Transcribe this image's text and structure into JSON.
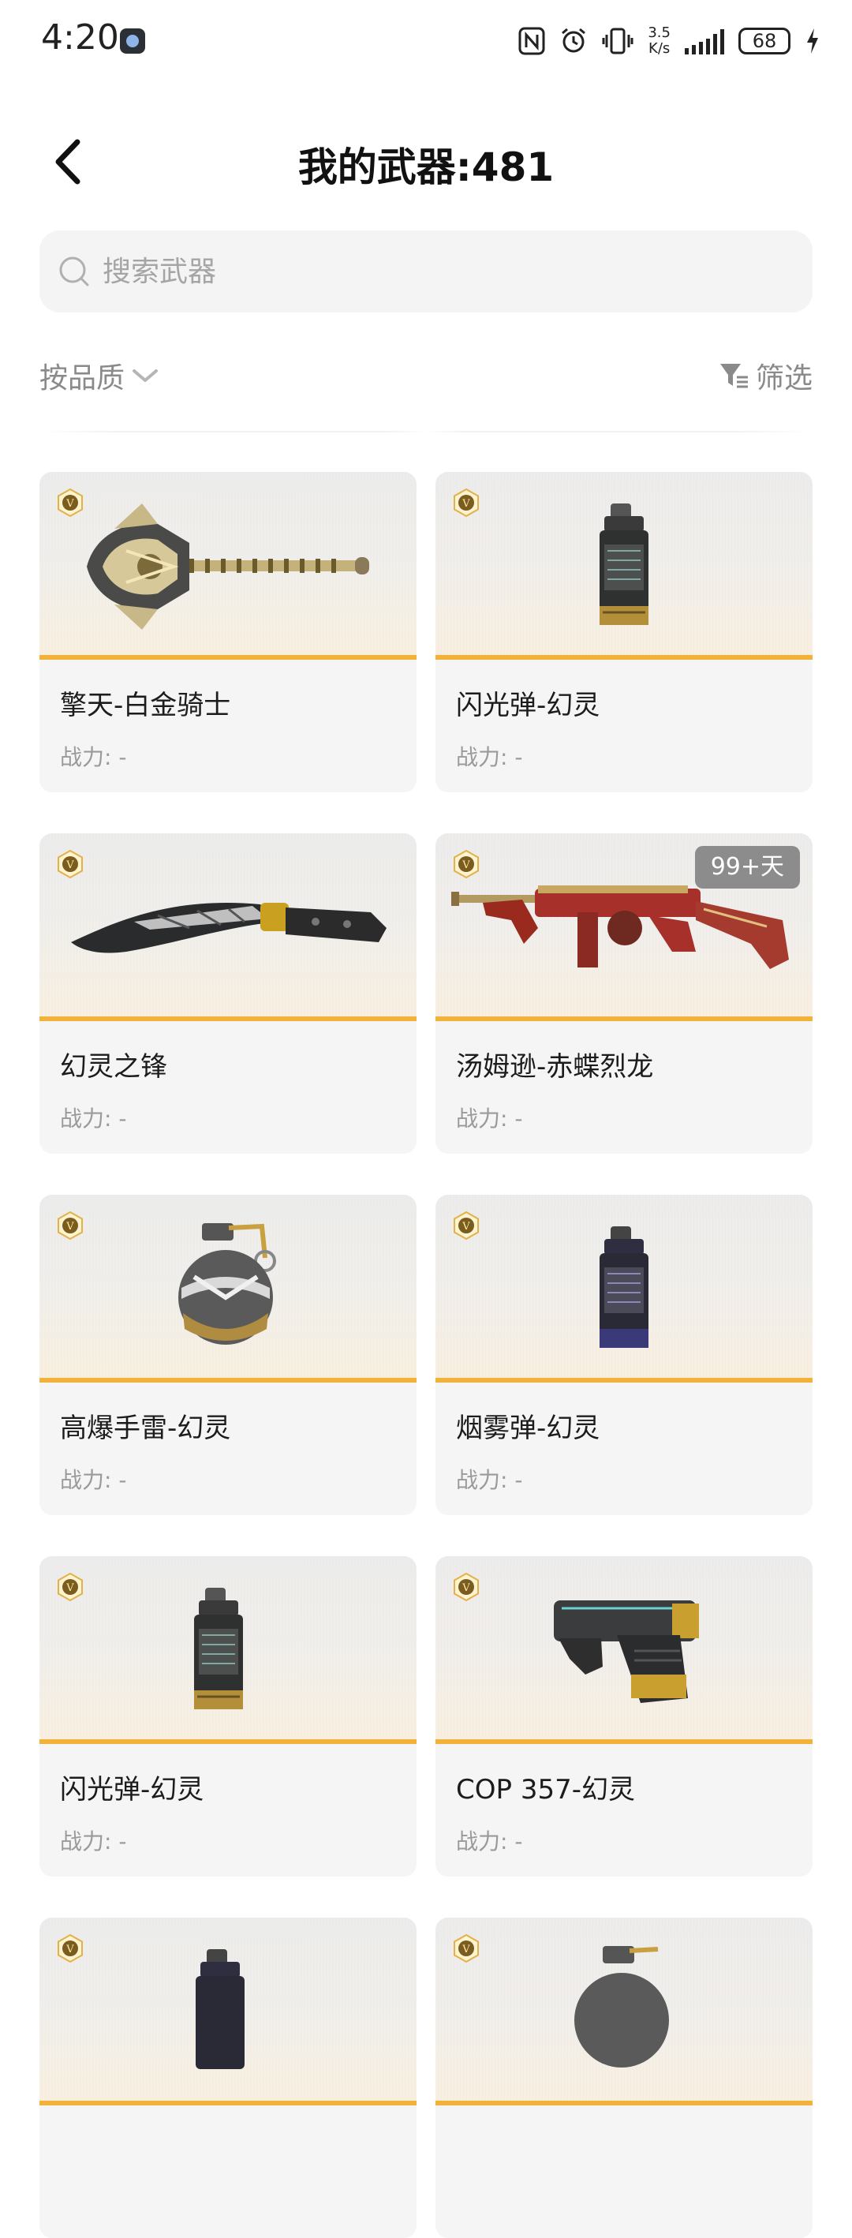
{
  "status_bar": {
    "time": "4:20",
    "net_speed_value": "3.5",
    "net_speed_unit": "K/s",
    "battery": "68"
  },
  "header": {
    "title": "我的武器:481"
  },
  "search": {
    "placeholder": "搜索武器",
    "value": ""
  },
  "toolbar": {
    "sort_label": "按品质",
    "filter_label": "筛选"
  },
  "weapons": [
    {
      "name": "擎天-白金骑士",
      "power": "战力: -",
      "art": "shovel-icon"
    },
    {
      "name": "闪光弹-幻灵",
      "power": "战力: -",
      "art": "flashbang-icon"
    },
    {
      "name": "幻灵之锋",
      "power": "战力: -",
      "art": "kukri-knife-icon"
    },
    {
      "name": "汤姆逊-赤蝶烈龙",
      "power": "战力: -",
      "art": "tommy-gun-icon",
      "badge": "99+天"
    },
    {
      "name": "高爆手雷-幻灵",
      "power": "战力: -",
      "art": "frag-grenade-icon"
    },
    {
      "name": "烟雾弹-幻灵",
      "power": "战力: -",
      "art": "smoke-grenade-icon"
    },
    {
      "name": "闪光弹-幻灵",
      "power": "战力: -",
      "art": "flashbang-icon"
    },
    {
      "name": "COP 357-幻灵",
      "power": "战力: -",
      "art": "pistol-icon"
    }
  ],
  "colors": {
    "accent_orange": "#f2b23a",
    "card_bg": "#f5f5f5",
    "badge_gray": "#8c8c8c"
  }
}
